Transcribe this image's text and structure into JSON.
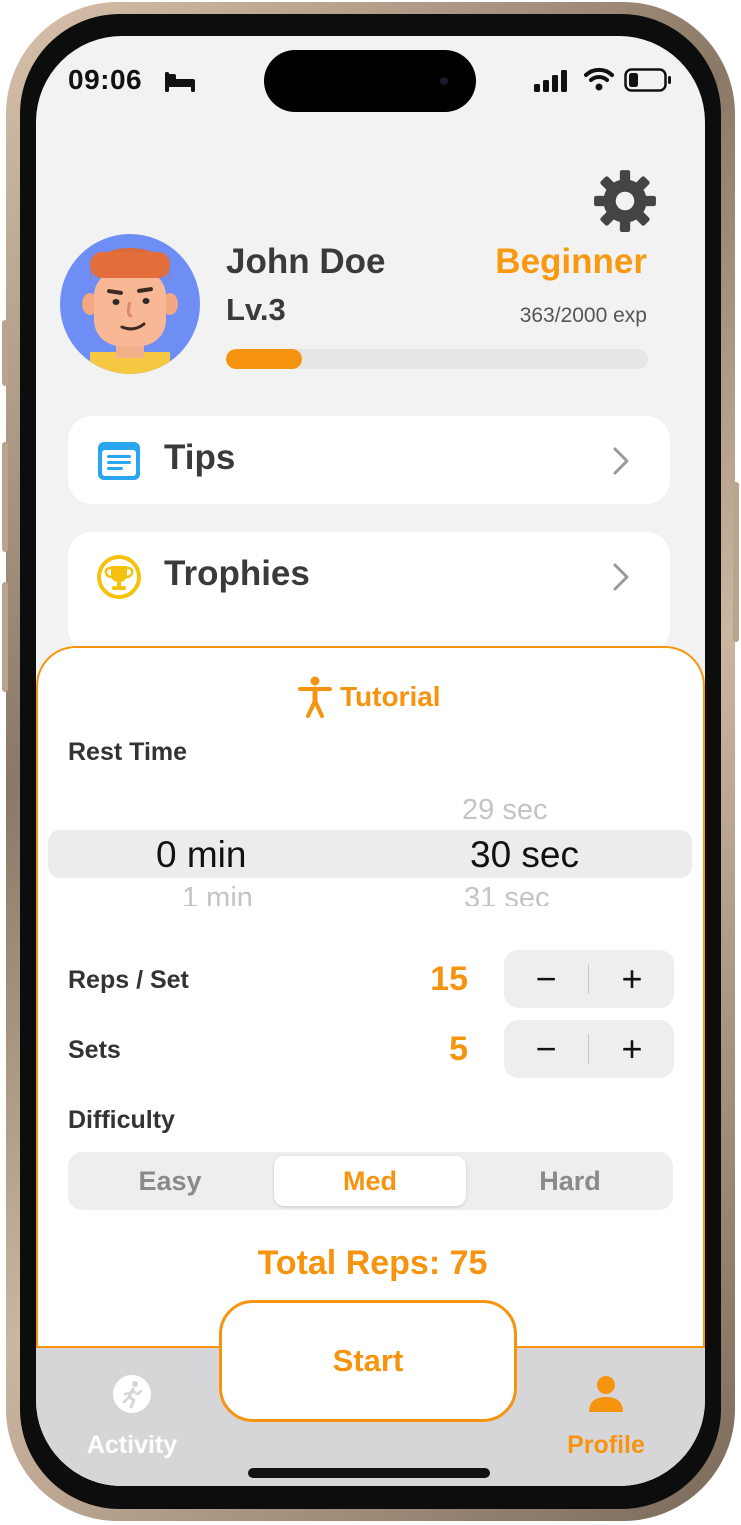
{
  "status_bar": {
    "time": "09:06"
  },
  "profile": {
    "name": "John Doe",
    "level": "Lv.3",
    "rank": "Beginner",
    "exp_text": "363/2000 exp",
    "exp_progress": 0.18
  },
  "menu": [
    {
      "label": "Tips",
      "icon": "notes-icon"
    },
    {
      "label": "Trophies",
      "icon": "trophy-icon"
    }
  ],
  "workout": {
    "tutorial_label": "Tutorial",
    "rest_time": {
      "label": "Rest Time",
      "minutes": {
        "prev": "",
        "selected": "0 min",
        "next": "1 min"
      },
      "seconds": {
        "prev": "29 sec",
        "selected": "30 sec",
        "next": "31 sec"
      }
    },
    "reps_per_set": {
      "label": "Reps / Set",
      "value": "15"
    },
    "sets": {
      "label": "Sets",
      "value": "5"
    },
    "stepper": {
      "minus": "−",
      "plus": "+"
    },
    "difficulty": {
      "label": "Difficulty",
      "options": [
        "Easy",
        "Med",
        "Hard"
      ],
      "selected": "Med"
    },
    "total_reps": "Total Reps: 75"
  },
  "tabbar": {
    "start_label": "Start",
    "tabs": [
      {
        "label": "Activity",
        "icon": "running-icon",
        "active": false
      },
      {
        "label": "Profile",
        "icon": "person-icon",
        "active": true
      }
    ]
  },
  "colors": {
    "accent": "#f7940f",
    "text_dark": "#3a3a3a",
    "tab_inactive": "#ffffff",
    "avatar_bg": "#6e8df5"
  }
}
